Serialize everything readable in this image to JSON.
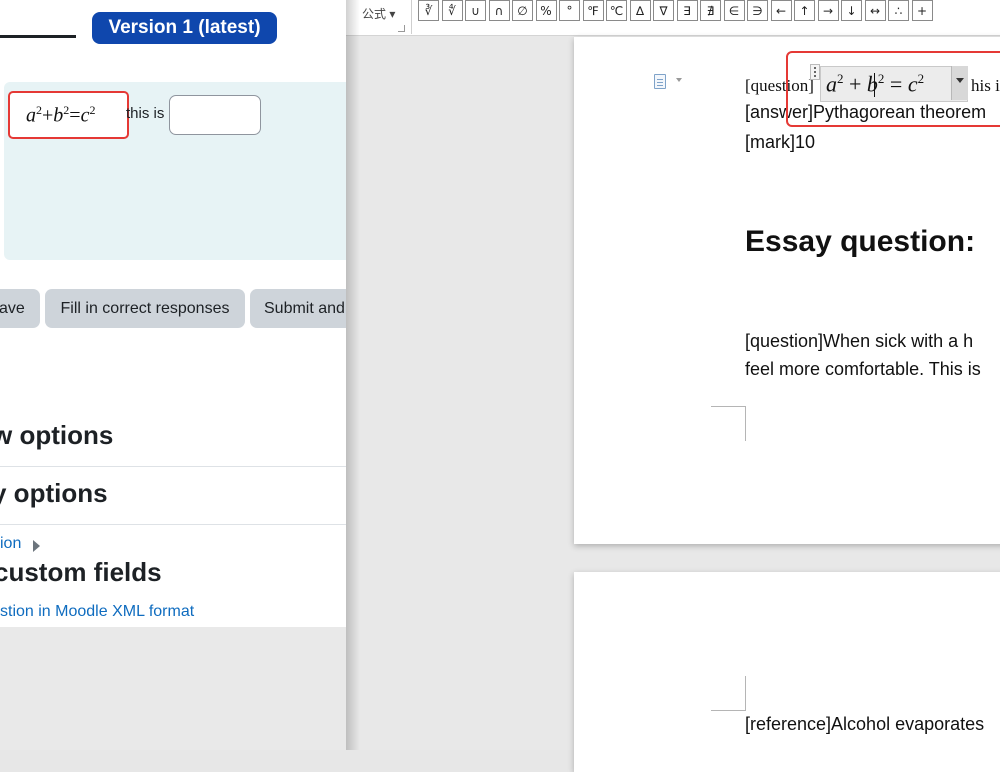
{
  "moodle": {
    "version_badge": "Version 1 (latest)",
    "formula_preview": {
      "a": "a",
      "b": "b",
      "c": "c",
      "exp": "2",
      "plus": "+",
      "equals": "="
    },
    "this_is_text": "this is",
    "answer_input": {
      "value": "",
      "placeholder": ""
    },
    "buttons": {
      "save": "ave",
      "fill": "Fill in correct responses",
      "submit": "Submit and"
    },
    "sections": [
      "w options",
      "y options"
    ],
    "question_link": "ion",
    "custom_fields_heading": "custom fields",
    "xml_link": "stion in Moodle XML format",
    "colors": {
      "badge": "#0f47ad",
      "link": "#0f6cbf",
      "highlight": "#e53935"
    }
  },
  "editor": {
    "formula_group_label": "公式",
    "symbols": [
      "∛",
      "∜",
      "∪",
      "∩",
      "∅",
      "%",
      "°",
      "℉",
      "℃",
      "∆",
      "∇",
      "∃",
      "∄",
      "∈",
      "∋",
      "←",
      "↑",
      "→",
      "↓",
      "↔",
      "∴",
      "+"
    ],
    "question_tag": "[question]",
    "math_object": {
      "a": "a",
      "b": "b",
      "c": "c",
      "exp": "2",
      "plus": "+",
      "equals": "="
    },
    "question_tail": "his is",
    "answer_line": "[answer]Pythagorean theorem",
    "mark_line": "[mark]10",
    "essay_heading": "Essay question:",
    "essay_question_line1": "[question]When sick with a h",
    "essay_question_line2": "feel more comfortable. This is",
    "reference_line": "[reference]Alcohol evaporates"
  }
}
